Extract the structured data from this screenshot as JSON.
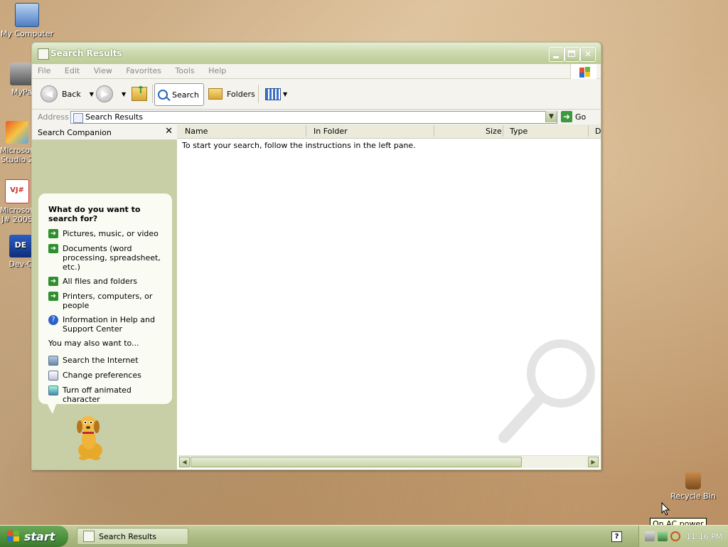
{
  "desktop": {
    "icons": [
      {
        "label": "My Computer"
      },
      {
        "label": "MyPa"
      },
      {
        "label": "Microsoft",
        "label2": "Studio 2"
      },
      {
        "label": "Microsoft",
        "label2": "J# 2005"
      },
      {
        "label": "Dev-C"
      },
      {
        "label": "Recycle Bin"
      }
    ]
  },
  "window": {
    "title": "Search Results",
    "menu": [
      "File",
      "Edit",
      "View",
      "Favorites",
      "Tools",
      "Help"
    ],
    "toolbar": {
      "back_label": "Back",
      "search_label": "Search",
      "folders_label": "Folders"
    },
    "address": {
      "label": "Address",
      "value": "Search Results",
      "go_label": "Go"
    }
  },
  "search_companion": {
    "header": "Search Companion",
    "question": "What do you want to search for?",
    "options": [
      {
        "label": "Pictures, music, or video",
        "icon": "green-arrow-icon"
      },
      {
        "label": "Documents (word processing, spreadsheet, etc.)",
        "icon": "green-arrow-icon"
      },
      {
        "label": "All files and folders",
        "icon": "green-arrow-icon"
      },
      {
        "label": "Printers, computers, or people",
        "icon": "green-arrow-icon"
      },
      {
        "label": "Information in Help and Support Center",
        "icon": "help-question-icon"
      }
    ],
    "also_heading": "You may also want to...",
    "also_options": [
      {
        "label": "Search the Internet",
        "icon": "search-internet-icon"
      },
      {
        "label": "Change preferences",
        "icon": "preferences-icon"
      },
      {
        "label": "Turn off animated character",
        "icon": "animated-character-icon"
      }
    ]
  },
  "results": {
    "columns": [
      "Name",
      "In Folder",
      "Size",
      "Type",
      "D"
    ],
    "hint": "To start your search, follow the instructions in the left pane."
  },
  "tooltip": "On AC power",
  "taskbar": {
    "start_label": "start",
    "task_label": "Search Results",
    "clock": "11:16 PM"
  },
  "colors": {
    "titlebar": "#c3d09c",
    "start_green": "#4c8f3a",
    "companion_bg": "#c8cfa6"
  }
}
